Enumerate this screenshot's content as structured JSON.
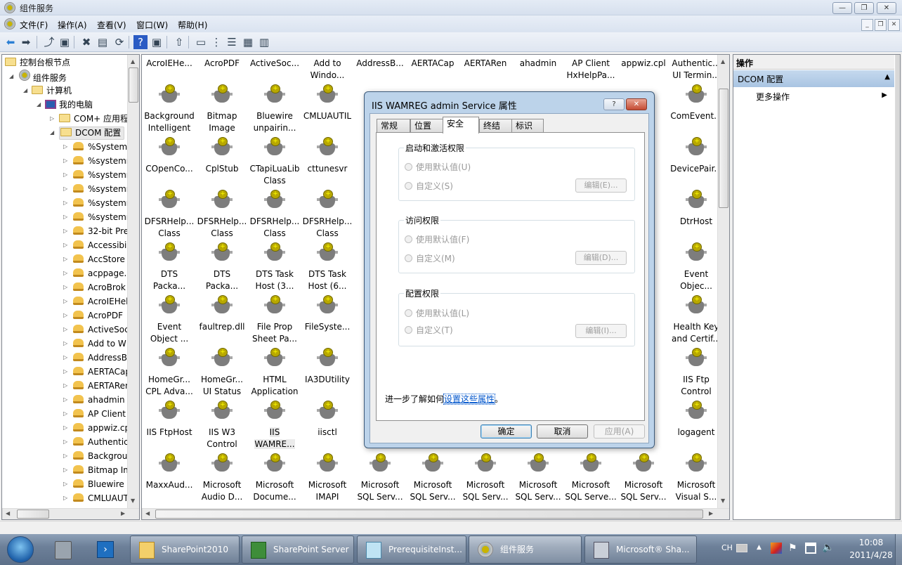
{
  "window": {
    "title": "组件服务",
    "min": "—",
    "restore": "❐",
    "close": "✕"
  },
  "menu": [
    "文件(F)",
    "操作(A)",
    "查看(V)",
    "窗口(W)",
    "帮助(H)"
  ],
  "mdi": {
    "min": "_",
    "restore": "❐",
    "close": "✕"
  },
  "toolbar": [
    {
      "name": "back-icon",
      "g": "⬅"
    },
    {
      "name": "forward-icon",
      "g": "➡"
    },
    {
      "name": "up-folder-icon",
      "g": "⤴"
    },
    {
      "name": "show-hide-tree-icon",
      "g": "▣"
    },
    {
      "name": "delete-icon",
      "g": "✖"
    },
    {
      "name": "properties-icon",
      "g": "▤"
    },
    {
      "name": "refresh-icon",
      "g": "⟳"
    },
    {
      "name": "help-icon",
      "g": "?"
    },
    {
      "name": "show-hide-action-icon",
      "g": "▣"
    },
    {
      "name": "export-icon",
      "g": "⇧"
    },
    {
      "name": "large-icons-view-icon",
      "g": "▭"
    },
    {
      "name": "small-icons-view-icon",
      "g": "⋮"
    },
    {
      "name": "list-view-icon",
      "g": "☰"
    },
    {
      "name": "detail-view-icon",
      "g": "▦"
    },
    {
      "name": "other-view-icon",
      "g": "▥"
    }
  ],
  "tree": {
    "root": "控制台根节点",
    "component_services": "组件服务",
    "computers": "计算机",
    "my_computer": "我的电脑",
    "com_plus": "COM+ 应用程",
    "dcom": "DCOM 配置",
    "items": [
      "%SystemF",
      "%systemr",
      "%systemr",
      "%systemr",
      "%systemr",
      "%systemr",
      "32-bit Pre",
      "Accessibil",
      "AccStore",
      "acppage.",
      "AcroBrok",
      "AcroIEHel",
      "AcroPDF",
      "ActiveSoc",
      "Add to W",
      "AddressB",
      "AERTACap",
      "AERTARen",
      "ahadmin",
      "AP Client",
      "appwiz.cp",
      "Authentica",
      "Backgrou",
      "Bitmap Im",
      "Bluewire u",
      "CMLUAUT"
    ]
  },
  "grid": [
    [
      "AcroIEHe...",
      "AcroPDF",
      "ActiveSoc...",
      "Add to\nWindo...",
      "AddressB...",
      "AERTACap",
      "AERTARen",
      "ahadmin",
      "AP Client\nHxHelpPa...",
      "appwiz.cpl",
      "Authentic...\nUI Termin..."
    ],
    [
      "Background\nIntelligent ...",
      "Bitmap\nImage",
      "Bluewire\nunpairin...",
      "CMLUAUTIL",
      "",
      "",
      "",
      "",
      "",
      "",
      "ComEvent..."
    ],
    [
      "COpenCo...",
      "CplStub",
      "CTapiLuaLib\nClass",
      "cttunesvr",
      "",
      "",
      "",
      "",
      "",
      "",
      "DevicePair..."
    ],
    [
      "DFSRHelp...\nClass",
      "DFSRHelp...\nClass",
      "DFSRHelp...\nClass",
      "DFSRHelp...\nClass",
      "",
      "",
      "",
      "",
      "",
      "",
      "DtrHost"
    ],
    [
      "DTS\nPacka...",
      "DTS\nPacka...",
      "DTS Task\nHost (3...",
      "DTS Task\nHost (6...",
      "",
      "",
      "",
      "",
      "",
      "",
      "Event\nObjec..."
    ],
    [
      "Event\nObject ...",
      "faultrep.dll",
      "File Prop\nSheet Pa...",
      "FileSyste...",
      "",
      "",
      "",
      "",
      "",
      "",
      "Health Key\nand Certif..."
    ],
    [
      "HomeGr...\nCPL Adva...",
      "HomeGr...\nUI Status",
      "HTML\nApplication",
      "IA3DUtility",
      "",
      "",
      "",
      "",
      "",
      "",
      "IIS Ftp\nControl"
    ],
    [
      "IIS FtpHost",
      "IIS W3\nControl",
      "IIS\nWAMRE...",
      "iisctl",
      "",
      "",
      "",
      "",
      "",
      "",
      "logagent"
    ],
    [
      "MaxxAud...",
      "Microsoft\nAudio D...",
      "Microsoft\nDocume...",
      "Microsoft\nIMAPI",
      "Microsoft\nSQL Serv...",
      "Microsoft\nSQL Serv...",
      "Microsoft\nSQL Serv...",
      "Microsoft\nSQL Serv...",
      "Microsoft\nSQL Serve...",
      "Microsoft\nSQL Serv...",
      "Microsoft\nVisual S..."
    ]
  ],
  "actions": {
    "header": "操作",
    "section": "DCOM 配置",
    "more": "更多操作"
  },
  "dialog": {
    "title": "IIS WAMREG admin Service 属性",
    "help": "?",
    "close": "✕",
    "tabs": [
      "常规",
      "位置",
      "安全",
      "终结点",
      "标识"
    ],
    "groups": [
      {
        "title": "启动和激活权限",
        "default": "使用默认值(U)",
        "custom": "自定义(S)",
        "edit": "编辑(E)..."
      },
      {
        "title": "访问权限",
        "default": "使用默认值(F)",
        "custom": "自定义(M)",
        "edit": "编辑(D)..."
      },
      {
        "title": "配置权限",
        "default": "使用默认值(L)",
        "custom": "自定义(T)",
        "edit": "编辑(I)..."
      }
    ],
    "learn_prefix": "进一步了解如何",
    "learn_link": "设置这些属性",
    "learn_suffix": "。",
    "ok": "确定",
    "cancel": "取消",
    "apply": "应用(A)"
  },
  "taskbar": {
    "tasks": [
      "SharePoint2010",
      "SharePoint Server",
      "PrerequisiteInst...",
      "组件服务",
      "Microsoft® Sha..."
    ],
    "lang": "CH",
    "time": "10:08",
    "date": "2011/4/28"
  }
}
